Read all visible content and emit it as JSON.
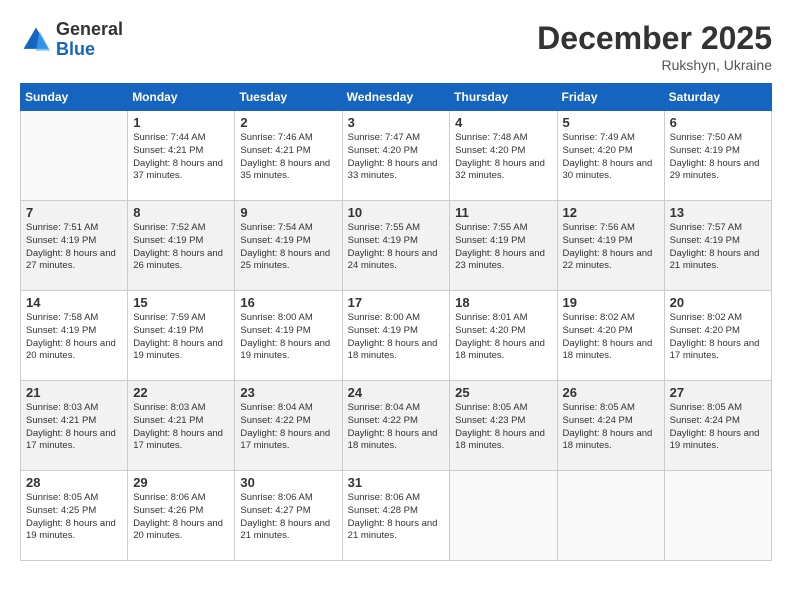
{
  "header": {
    "logo_line1": "General",
    "logo_line2": "Blue",
    "month": "December 2025",
    "location": "Rukshyn, Ukraine"
  },
  "weekdays": [
    "Sunday",
    "Monday",
    "Tuesday",
    "Wednesday",
    "Thursday",
    "Friday",
    "Saturday"
  ],
  "weeks": [
    [
      {
        "day": "",
        "sunrise": "",
        "sunset": "",
        "daylight": "",
        "empty": true
      },
      {
        "day": "1",
        "sunrise": "7:44 AM",
        "sunset": "4:21 PM",
        "daylight": "8 hours and 37 minutes."
      },
      {
        "day": "2",
        "sunrise": "7:46 AM",
        "sunset": "4:21 PM",
        "daylight": "8 hours and 35 minutes."
      },
      {
        "day": "3",
        "sunrise": "7:47 AM",
        "sunset": "4:20 PM",
        "daylight": "8 hours and 33 minutes."
      },
      {
        "day": "4",
        "sunrise": "7:48 AM",
        "sunset": "4:20 PM",
        "daylight": "8 hours and 32 minutes."
      },
      {
        "day": "5",
        "sunrise": "7:49 AM",
        "sunset": "4:20 PM",
        "daylight": "8 hours and 30 minutes."
      },
      {
        "day": "6",
        "sunrise": "7:50 AM",
        "sunset": "4:19 PM",
        "daylight": "8 hours and 29 minutes."
      }
    ],
    [
      {
        "day": "7",
        "sunrise": "7:51 AM",
        "sunset": "4:19 PM",
        "daylight": "8 hours and 27 minutes."
      },
      {
        "day": "8",
        "sunrise": "7:52 AM",
        "sunset": "4:19 PM",
        "daylight": "8 hours and 26 minutes."
      },
      {
        "day": "9",
        "sunrise": "7:54 AM",
        "sunset": "4:19 PM",
        "daylight": "8 hours and 25 minutes."
      },
      {
        "day": "10",
        "sunrise": "7:55 AM",
        "sunset": "4:19 PM",
        "daylight": "8 hours and 24 minutes."
      },
      {
        "day": "11",
        "sunrise": "7:55 AM",
        "sunset": "4:19 PM",
        "daylight": "8 hours and 23 minutes."
      },
      {
        "day": "12",
        "sunrise": "7:56 AM",
        "sunset": "4:19 PM",
        "daylight": "8 hours and 22 minutes."
      },
      {
        "day": "13",
        "sunrise": "7:57 AM",
        "sunset": "4:19 PM",
        "daylight": "8 hours and 21 minutes."
      }
    ],
    [
      {
        "day": "14",
        "sunrise": "7:58 AM",
        "sunset": "4:19 PM",
        "daylight": "8 hours and 20 minutes."
      },
      {
        "day": "15",
        "sunrise": "7:59 AM",
        "sunset": "4:19 PM",
        "daylight": "8 hours and 19 minutes."
      },
      {
        "day": "16",
        "sunrise": "8:00 AM",
        "sunset": "4:19 PM",
        "daylight": "8 hours and 19 minutes."
      },
      {
        "day": "17",
        "sunrise": "8:00 AM",
        "sunset": "4:19 PM",
        "daylight": "8 hours and 18 minutes."
      },
      {
        "day": "18",
        "sunrise": "8:01 AM",
        "sunset": "4:20 PM",
        "daylight": "8 hours and 18 minutes."
      },
      {
        "day": "19",
        "sunrise": "8:02 AM",
        "sunset": "4:20 PM",
        "daylight": "8 hours and 18 minutes."
      },
      {
        "day": "20",
        "sunrise": "8:02 AM",
        "sunset": "4:20 PM",
        "daylight": "8 hours and 17 minutes."
      }
    ],
    [
      {
        "day": "21",
        "sunrise": "8:03 AM",
        "sunset": "4:21 PM",
        "daylight": "8 hours and 17 minutes."
      },
      {
        "day": "22",
        "sunrise": "8:03 AM",
        "sunset": "4:21 PM",
        "daylight": "8 hours and 17 minutes."
      },
      {
        "day": "23",
        "sunrise": "8:04 AM",
        "sunset": "4:22 PM",
        "daylight": "8 hours and 17 minutes."
      },
      {
        "day": "24",
        "sunrise": "8:04 AM",
        "sunset": "4:22 PM",
        "daylight": "8 hours and 18 minutes."
      },
      {
        "day": "25",
        "sunrise": "8:05 AM",
        "sunset": "4:23 PM",
        "daylight": "8 hours and 18 minutes."
      },
      {
        "day": "26",
        "sunrise": "8:05 AM",
        "sunset": "4:24 PM",
        "daylight": "8 hours and 18 minutes."
      },
      {
        "day": "27",
        "sunrise": "8:05 AM",
        "sunset": "4:24 PM",
        "daylight": "8 hours and 19 minutes."
      }
    ],
    [
      {
        "day": "28",
        "sunrise": "8:05 AM",
        "sunset": "4:25 PM",
        "daylight": "8 hours and 19 minutes."
      },
      {
        "day": "29",
        "sunrise": "8:06 AM",
        "sunset": "4:26 PM",
        "daylight": "8 hours and 20 minutes."
      },
      {
        "day": "30",
        "sunrise": "8:06 AM",
        "sunset": "4:27 PM",
        "daylight": "8 hours and 21 minutes."
      },
      {
        "day": "31",
        "sunrise": "8:06 AM",
        "sunset": "4:28 PM",
        "daylight": "8 hours and 21 minutes."
      },
      {
        "day": "",
        "sunrise": "",
        "sunset": "",
        "daylight": "",
        "empty": true
      },
      {
        "day": "",
        "sunrise": "",
        "sunset": "",
        "daylight": "",
        "empty": true
      },
      {
        "day": "",
        "sunrise": "",
        "sunset": "",
        "daylight": "",
        "empty": true
      }
    ]
  ]
}
